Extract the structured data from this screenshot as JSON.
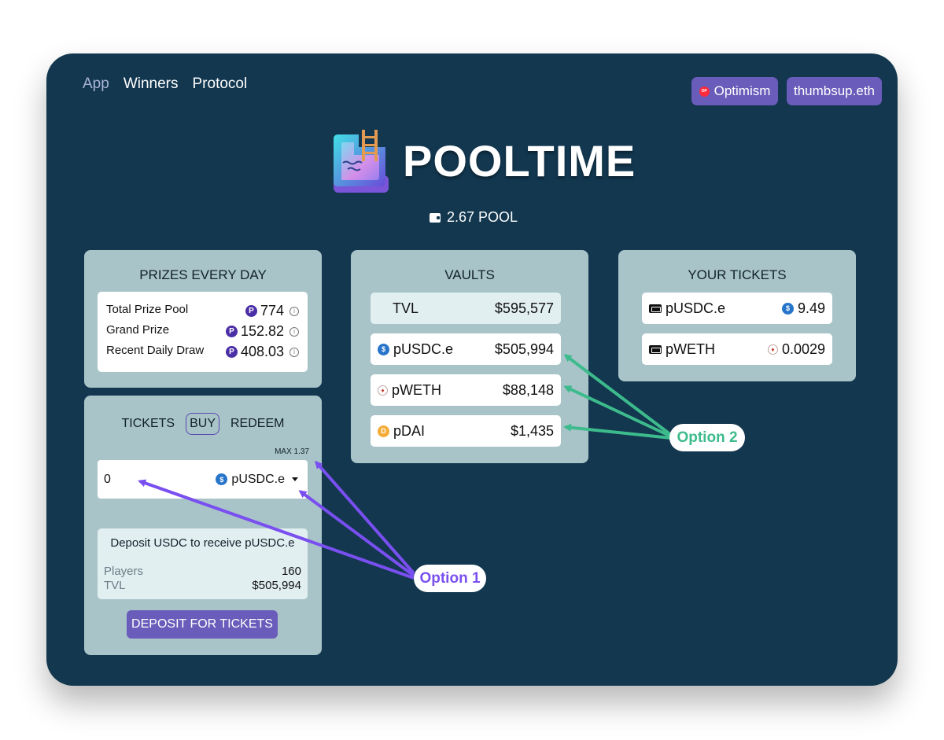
{
  "nav": {
    "items": [
      "App",
      "Winners",
      "Protocol"
    ],
    "active": "App"
  },
  "header": {
    "network_label": "Optimism",
    "network_icon": "OP",
    "account_label": "thumbsup.eth"
  },
  "brand": {
    "name": "POOLTIME",
    "balance": "2.67 POOL"
  },
  "prizes": {
    "title": "PRIZES EVERY DAY",
    "rows": [
      {
        "label": "Total Prize Pool",
        "value": "774"
      },
      {
        "label": "Grand Prize",
        "value": "152.82"
      },
      {
        "label": "Recent Daily Draw",
        "value": "408.03"
      }
    ],
    "coin_glyph": "P",
    "info_glyph": "i"
  },
  "vaults": {
    "title": "VAULTS",
    "tvl": {
      "label": "TVL",
      "value": "$595,577"
    },
    "rows": [
      {
        "token": "pUSDC.e",
        "value": "$505,994",
        "icon": "usdc-coin-icon"
      },
      {
        "token": "pWETH",
        "value": "$88,148",
        "icon": "eth-coin-icon"
      },
      {
        "token": "pDAI",
        "value": "$1,435",
        "icon": "dai-coin-icon"
      }
    ]
  },
  "tickets": {
    "title": "YOUR TICKETS",
    "rows": [
      {
        "token": "pUSDC.e",
        "amount": "9.49"
      },
      {
        "token": "pWETH",
        "amount": "0.0029"
      }
    ]
  },
  "trade": {
    "tab_tickets": "TICKETS",
    "tab_buy": "BUY",
    "tab_redeem": "REDEEM",
    "max_label": "MAX 1.37",
    "amount_value": "0",
    "token_selected": "pUSDC.e",
    "info_title": "Deposit USDC to receive pUSDC.e",
    "players_label": "Players",
    "players_value": "160",
    "tvl_label": "TVL",
    "tvl_value": "$505,994",
    "deposit_button": "DEPOSIT FOR TICKETS"
  },
  "annotations": {
    "option1": "Option 1",
    "option2": "Option 2",
    "option1_color": "#7a4ff0",
    "option2_color": "#3dbb8c"
  },
  "colors": {
    "background": "#12374f",
    "card": "#a8c4c9",
    "accent": "#6a5cba"
  }
}
